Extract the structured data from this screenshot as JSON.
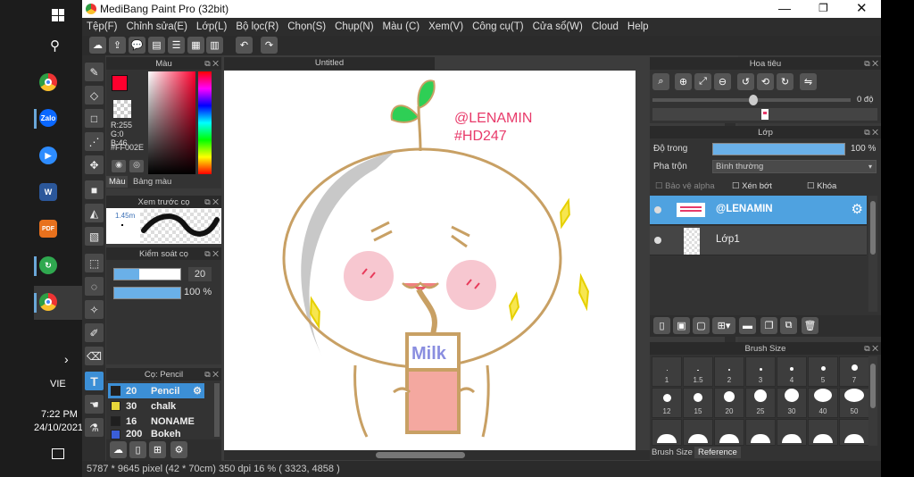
{
  "taskbar": {
    "language": "VIE",
    "time": "7:22 PM",
    "date": "24/10/2021",
    "icons": [
      "windows-start-icon",
      "search-icon",
      "chrome-icon",
      "zalo-icon",
      "zoom-icon",
      "word-icon",
      "pdf-icon",
      "app-green-icon",
      "chrome-active-icon"
    ],
    "zalo_label": "Zalo",
    "pdf_label": "PDF",
    "word_label": "W"
  },
  "window": {
    "title": "MediBang Paint Pro (32bit)"
  },
  "menu": [
    "Tệp(F)",
    "Chỉnh sửa(E)",
    "Lớp(L)",
    "Bộ lọc(R)",
    "Chọn(S)",
    "Chụp(N)",
    "Màu (C)",
    "Xem(V)",
    "Công cụ(T)",
    "Cửa sổ(W)",
    "Cloud",
    "Help"
  ],
  "color_panel": {
    "title": "Màu",
    "r": "R:255",
    "g": "G:0",
    "b": "B:46",
    "hex": "#FF002E",
    "tab1": "Màu",
    "tab2": "Bảng màu",
    "primary_color": "#FF002E"
  },
  "brush_preview": {
    "title": "Xem trước cọ",
    "size": "1.45m"
  },
  "brush_control": {
    "title": "Kiểm soát cọ",
    "size_value": "20",
    "opacity_value": "100 %",
    "size_fraction": 0.38,
    "opacity_fraction": 1.0
  },
  "brush_list": {
    "title": "Cọ: Pencil",
    "items": [
      {
        "size": "20",
        "name": "Pencil",
        "color": "#1f1f1f"
      },
      {
        "size": "30",
        "name": "chalk",
        "color": "#e6d63a"
      },
      {
        "size": "16",
        "name": "NONAME",
        "color": "#1f1f1f"
      },
      {
        "size": "200",
        "name": "Bokeh",
        "color": "#3a5ed8"
      }
    ]
  },
  "canvas": {
    "tab": "Untitled",
    "watermark1": "@LENAMIN",
    "watermark2": "#HD247",
    "milk_text": "Milk"
  },
  "navigator": {
    "title": "Hoa tiêu",
    "angle": "0 độ"
  },
  "layer_panel": {
    "title": "Lớp",
    "opacity_label": "Độ trong",
    "opacity_value": "100 %",
    "blend_label": "Pha trộn",
    "blend_value": "Bình thường",
    "protect_alpha": "Bảo vệ alpha",
    "clipping": "Xén bớt",
    "lock": "Khóa",
    "layers": [
      {
        "name": "@LENAMIN",
        "selected": true
      },
      {
        "name": "Lớp1",
        "selected": false
      }
    ]
  },
  "brush_size_panel": {
    "title": "Brush Size",
    "sizes": [
      "1",
      "1.5",
      "2",
      "3",
      "4",
      "5",
      "7",
      "12",
      "15",
      "20",
      "25",
      "30",
      "40",
      "50"
    ],
    "tab1": "Brush Size",
    "tab2": "Reference"
  },
  "status": "5787 * 9645 pixel  (42 * 70cm)  350 dpi   16 %   ( 3323, 4858 )"
}
